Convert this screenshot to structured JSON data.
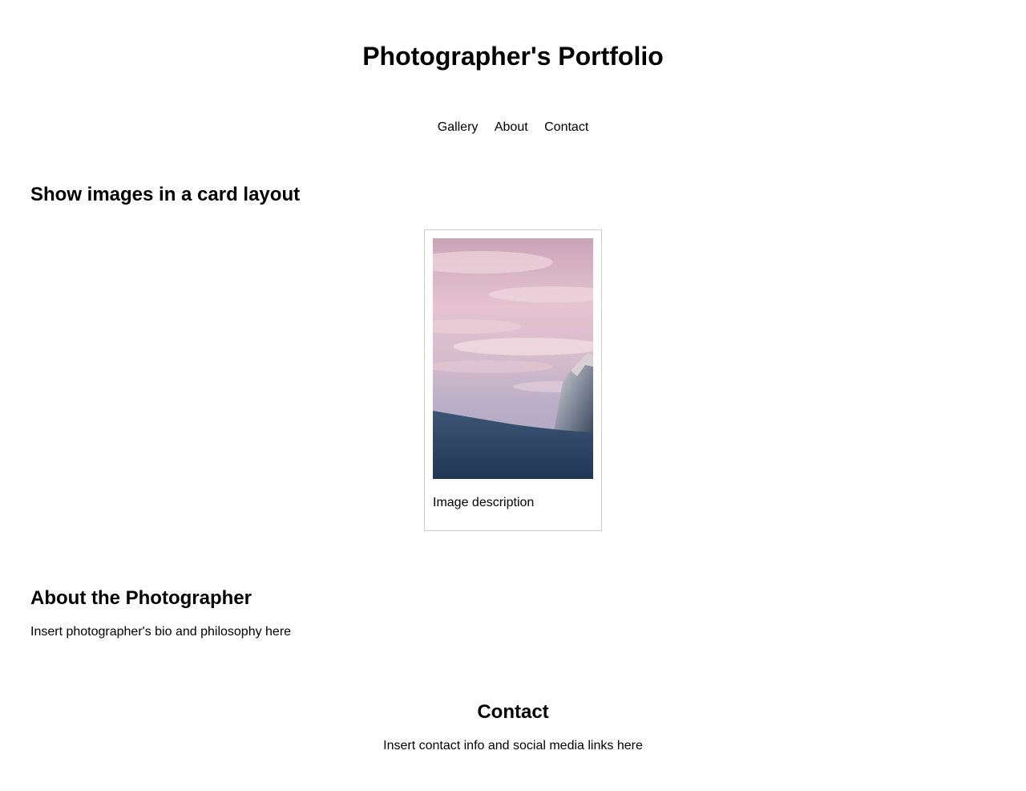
{
  "header": {
    "title": "Photographer's Portfolio"
  },
  "nav": {
    "items": [
      {
        "label": "Gallery"
      },
      {
        "label": "About"
      },
      {
        "label": "Contact"
      }
    ]
  },
  "gallery": {
    "heading": "Show images in a card layout",
    "cards": [
      {
        "image_subject": "snowy-mountain-peak-at-sunset-photo",
        "caption": "Image description"
      }
    ]
  },
  "about": {
    "heading": "About the Photographer",
    "text": "Insert photographer's bio and philosophy here"
  },
  "contact": {
    "heading": "Contact",
    "text": "Insert contact info and social media links here"
  },
  "colors": {
    "text": "#000000",
    "background": "#ffffff",
    "card_border": "#cccccc"
  }
}
